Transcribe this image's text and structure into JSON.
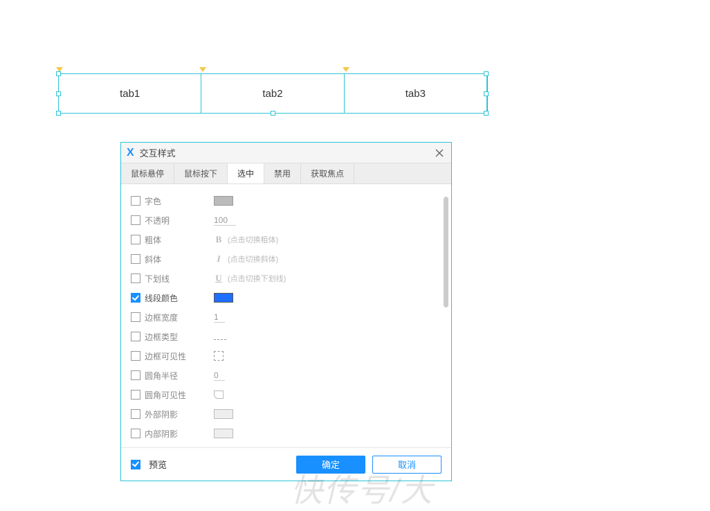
{
  "canvas": {
    "tabs": [
      "tab1",
      "tab2",
      "tab3"
    ]
  },
  "dialog": {
    "title": "交互样式",
    "tabs": [
      {
        "label": "鼠标悬停",
        "active": false
      },
      {
        "label": "鼠标按下",
        "active": false
      },
      {
        "label": "选中",
        "active": true
      },
      {
        "label": "禁用",
        "active": false
      },
      {
        "label": "获取焦点",
        "active": false
      }
    ],
    "properties": {
      "text_color": {
        "label": "字色",
        "checked": false
      },
      "opacity": {
        "label": "不透明",
        "checked": false,
        "value": "100"
      },
      "bold": {
        "label": "粗体",
        "checked": false,
        "hint": "(点击切换粗体)"
      },
      "italic": {
        "label": "斜体",
        "checked": false,
        "hint": "(点击切换斜体)"
      },
      "underline": {
        "label": "下划线",
        "checked": false,
        "hint": "(点击切换下划线)"
      },
      "line_color": {
        "label": "线段颜色",
        "checked": true
      },
      "border_width": {
        "label": "边框宽度",
        "checked": false,
        "value": "1"
      },
      "border_type": {
        "label": "边框类型",
        "checked": false
      },
      "border_vis": {
        "label": "边框可见性",
        "checked": false
      },
      "corner_radius": {
        "label": "圆角半径",
        "checked": false,
        "value": "0"
      },
      "corner_vis": {
        "label": "圆角可见性",
        "checked": false
      },
      "outer_shadow": {
        "label": "外部阴影",
        "checked": false
      },
      "inner_shadow": {
        "label": "内部阴影",
        "checked": false
      }
    },
    "footer": {
      "preview_label": "预览",
      "preview_checked": true,
      "ok": "确定",
      "cancel": "取消"
    }
  },
  "watermark": "快传号/大"
}
